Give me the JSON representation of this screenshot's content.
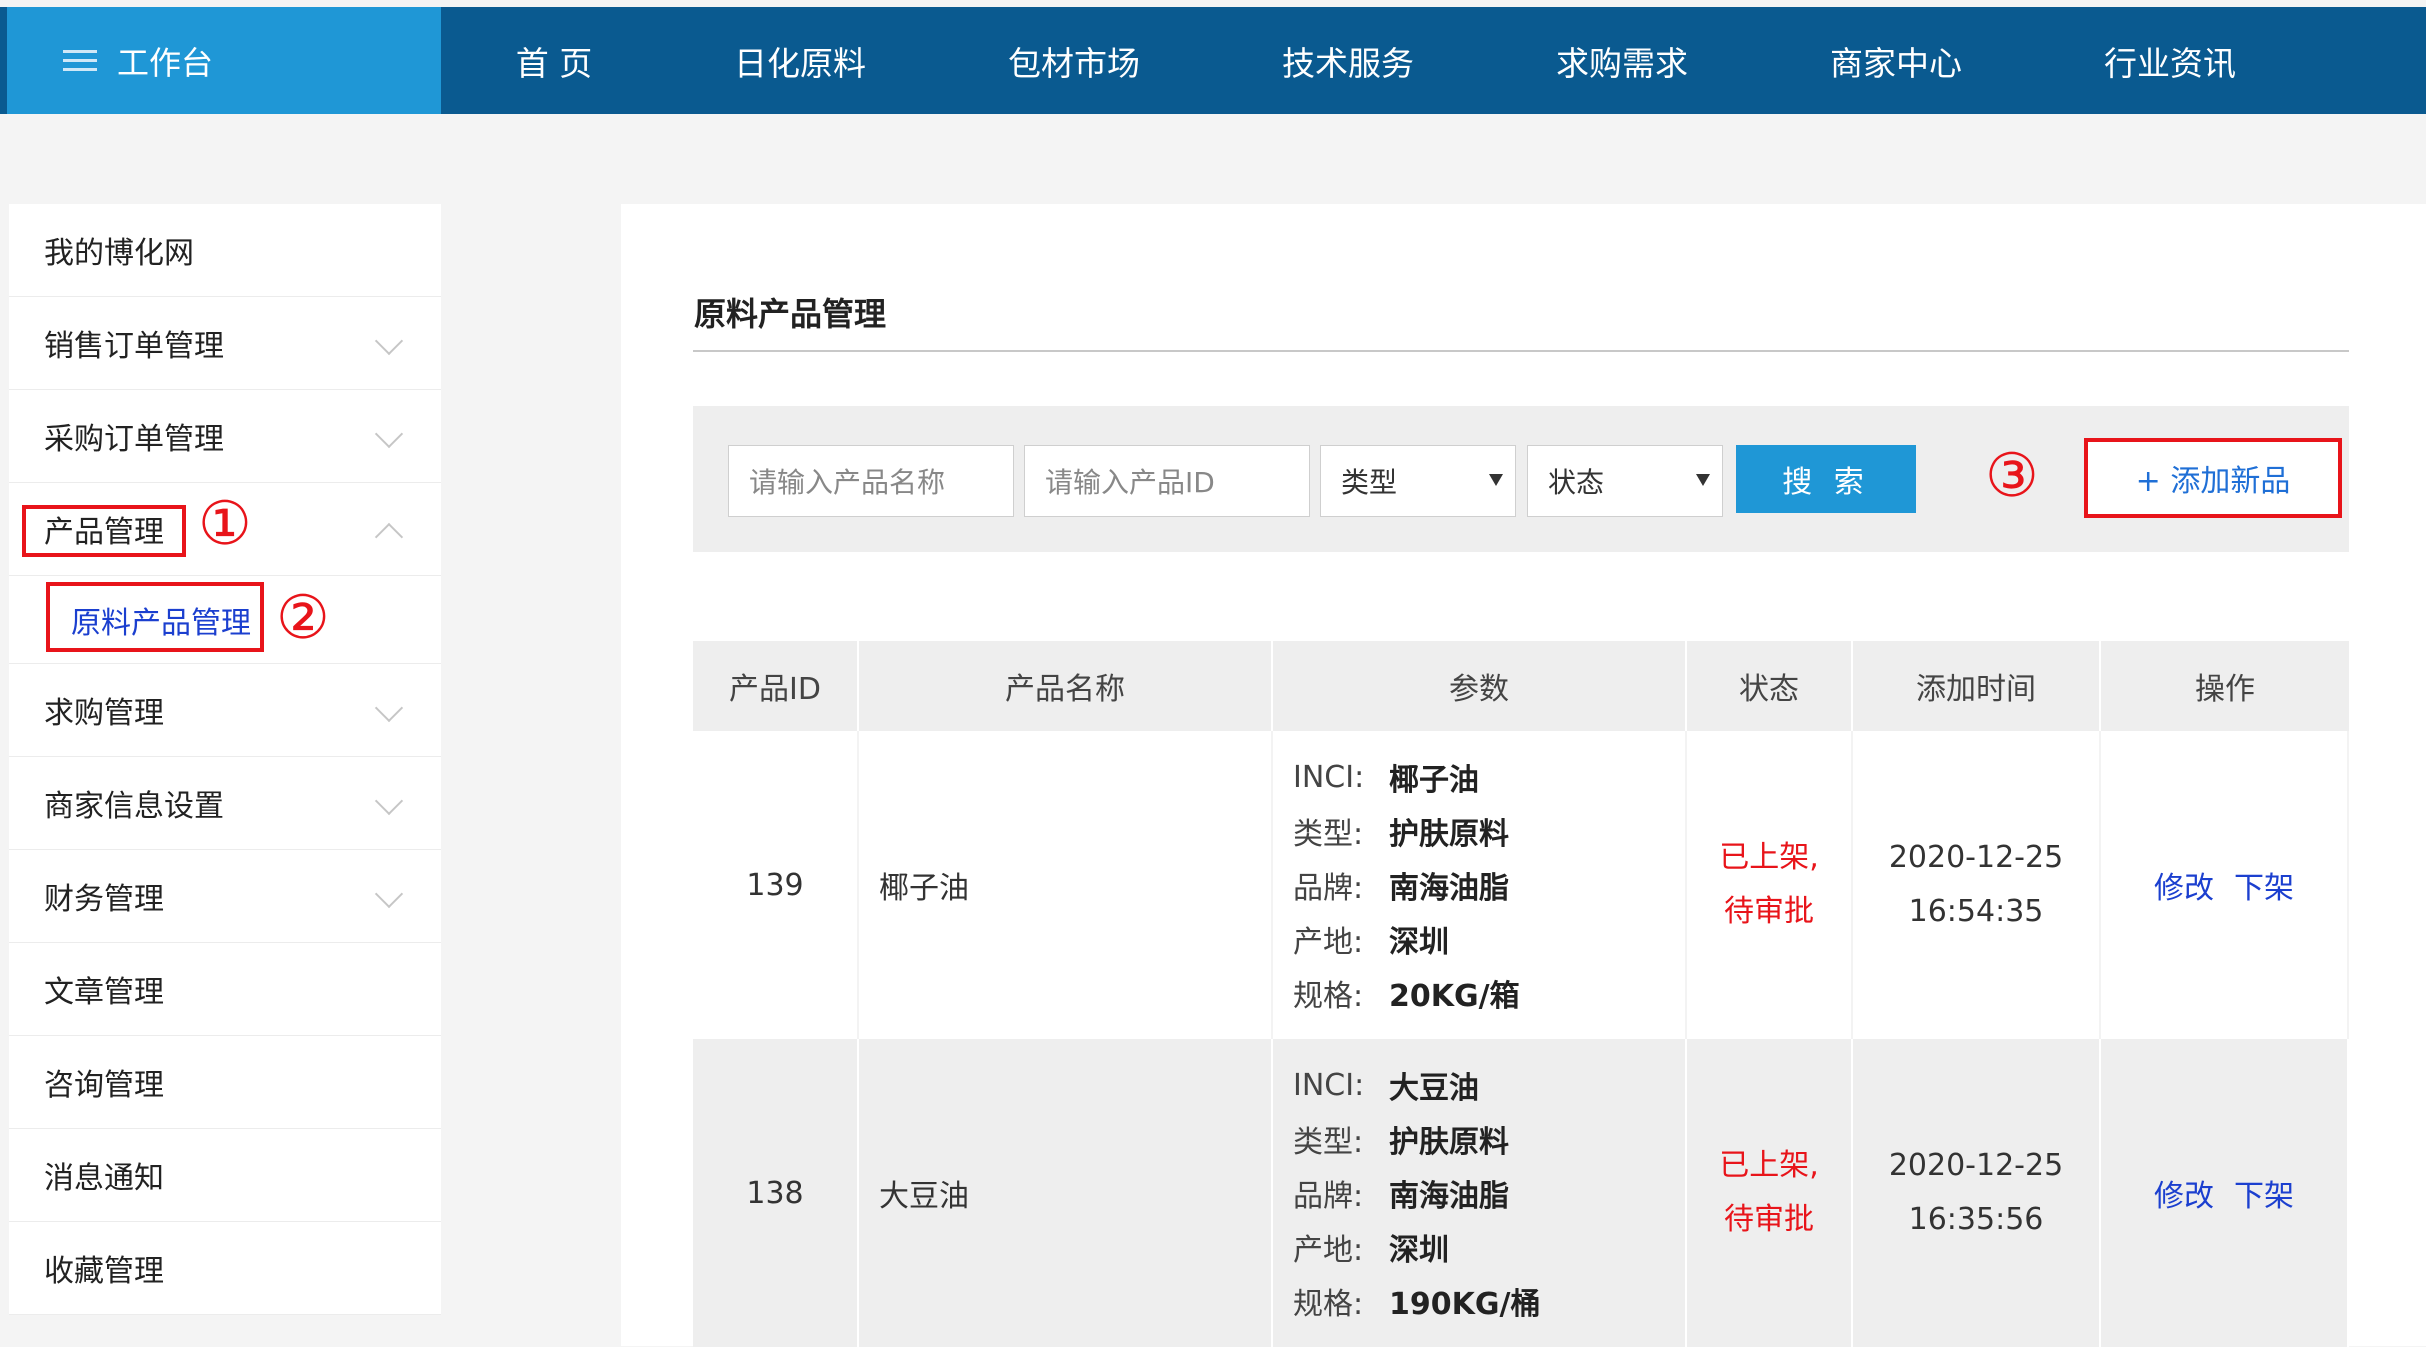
{
  "brand": {
    "label": "工作台"
  },
  "nav": [
    "首 页",
    "日化原料",
    "包材市场",
    "技术服务",
    "求购需求",
    "商家中心",
    "行业资讯"
  ],
  "sidebar": {
    "items": [
      {
        "label": "我的博化网"
      },
      {
        "label": "销售订单管理"
      },
      {
        "label": "采购订单管理"
      },
      {
        "label": "产品管理"
      },
      {
        "label": "原料产品管理"
      },
      {
        "label": "求购管理"
      },
      {
        "label": "商家信息设置"
      },
      {
        "label": "财务管理"
      },
      {
        "label": "文章管理"
      },
      {
        "label": "咨询管理"
      },
      {
        "label": "消息通知"
      },
      {
        "label": "收藏管理"
      }
    ]
  },
  "annotations": {
    "one": "①",
    "two": "②",
    "three": "③"
  },
  "main": {
    "title": "原料产品管理",
    "filter": {
      "name_placeholder": "请输入产品名称",
      "id_placeholder": "请输入产品ID",
      "type_select": "类型",
      "status_select": "状态",
      "search_label": "搜 索",
      "add_label": "+ 添加新品"
    },
    "table": {
      "headers": [
        "产品ID",
        "产品名称",
        "参数",
        "状态",
        "添加时间",
        "操作"
      ],
      "param_keys": [
        "INCI:",
        "类型:",
        "品牌:",
        "产地:",
        "规格:"
      ],
      "rows": [
        {
          "id": "139",
          "name": "椰子油",
          "params": [
            "椰子油",
            "护肤原料",
            "南海油脂",
            "深圳",
            "20KG/箱"
          ],
          "status1": "已上架,",
          "status2": "待审批",
          "date": "2020-12-25",
          "time": "16:54:35",
          "edit": "修改",
          "offline": "下架"
        },
        {
          "id": "138",
          "name": "大豆油",
          "params": [
            "大豆油",
            "护肤原料",
            "南海油脂",
            "深圳",
            "190KG/桶"
          ],
          "status1": "已上架,",
          "status2": "待审批",
          "date": "2020-12-25",
          "time": "16:35:56",
          "edit": "修改",
          "offline": "下架"
        }
      ]
    }
  },
  "colors": {
    "nav_bg": "#0a5a90",
    "brand_bg": "#1f97d6",
    "accent_red": "#e8141a",
    "link_blue": "#1b3fcf"
  }
}
